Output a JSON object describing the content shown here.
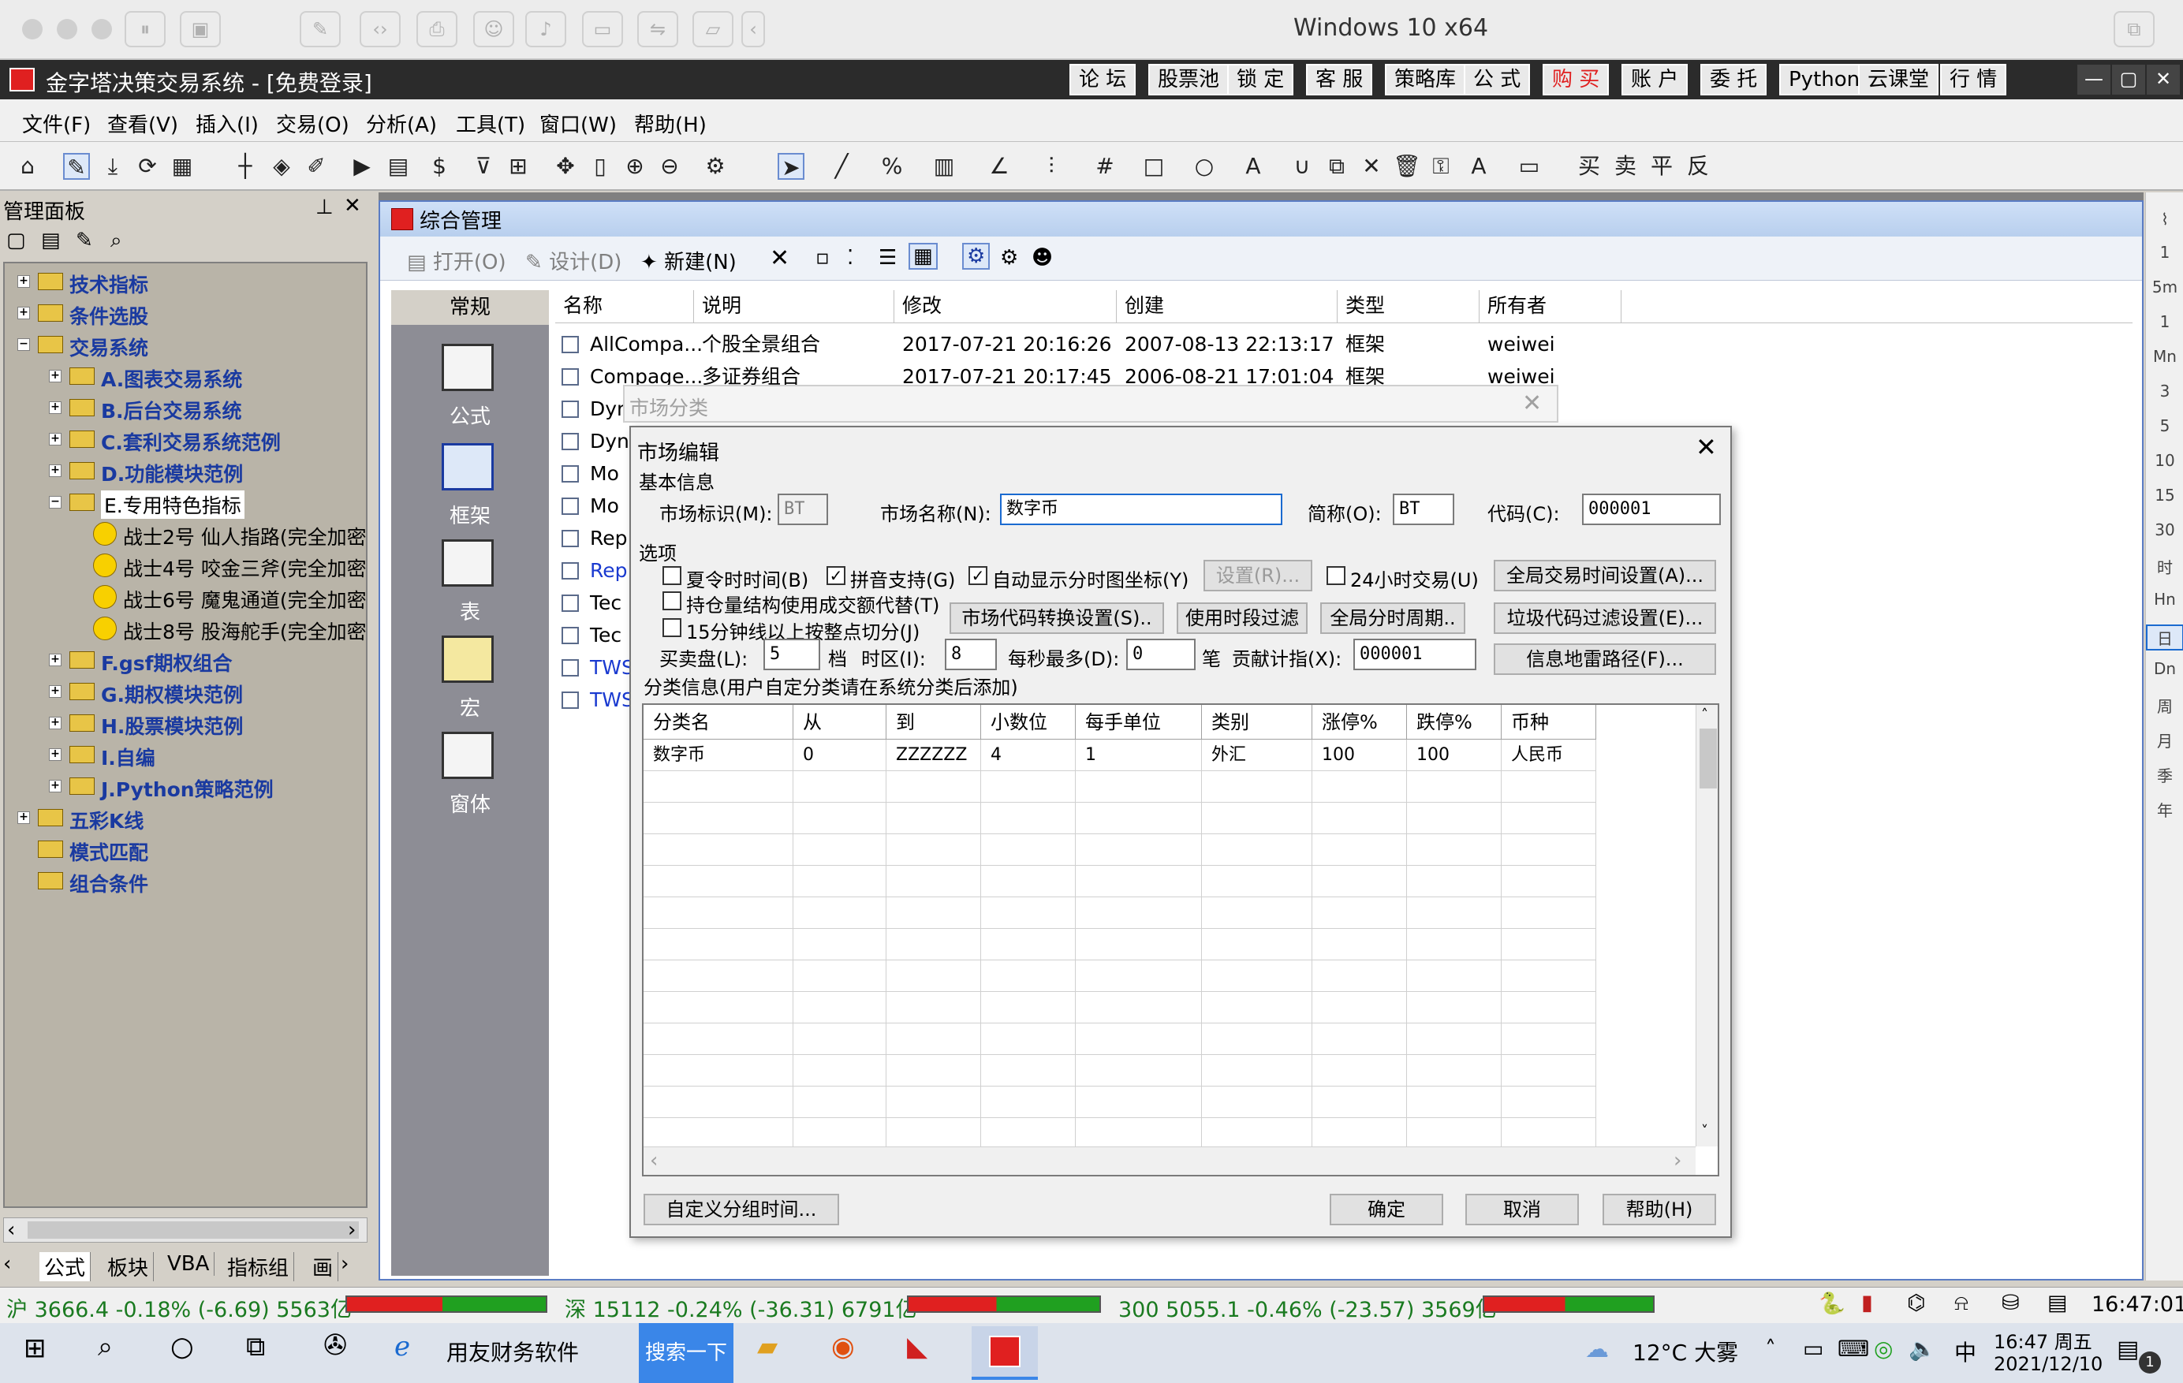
{
  "vm": {
    "title": "Windows 10 x64"
  },
  "app": {
    "title": "金字塔决策交易系统 - [免费登录]",
    "buttons": [
      "论 坛",
      "股票池",
      "锁 定",
      "客 服",
      "策略库",
      "公 式",
      "购 买",
      "账 户",
      "委 托",
      "Python",
      "云课堂",
      "行 情"
    ],
    "accent": "#e02020"
  },
  "menu": [
    "文件(F)",
    "查看(V)",
    "插入(I)",
    "交易(O)",
    "分析(A)",
    "工具(T)",
    "窗口(W)",
    "帮助(H)"
  ],
  "left": {
    "title": "管理面板",
    "tree": [
      {
        "label": "技术指标",
        "depth": 0,
        "expand": "+"
      },
      {
        "label": "条件选股",
        "depth": 0,
        "expand": "+"
      },
      {
        "label": "交易系统",
        "depth": 0,
        "expand": "-"
      },
      {
        "label": "A.图表交易系统",
        "depth": 1,
        "expand": "+"
      },
      {
        "label": "B.后台交易系统",
        "depth": 1,
        "expand": "+"
      },
      {
        "label": "C.套利交易系统范例",
        "depth": 1,
        "expand": "+"
      },
      {
        "label": "D.功能模块范例",
        "depth": 1,
        "expand": "+"
      },
      {
        "label": "E.专用特色指标",
        "depth": 1,
        "expand": "-"
      },
      {
        "label": "战士2号    仙人指路(完全加密",
        "depth": 2,
        "expand": ""
      },
      {
        "label": "战士4号    咬金三斧(完全加密",
        "depth": 2,
        "expand": ""
      },
      {
        "label": "战士6号    魔鬼通道(完全加密",
        "depth": 2,
        "expand": ""
      },
      {
        "label": "战士8号    股海舵手(完全加密",
        "depth": 2,
        "expand": ""
      },
      {
        "label": "F.gsf期权组合",
        "depth": 1,
        "expand": "+"
      },
      {
        "label": "G.期权模块范例",
        "depth": 1,
        "expand": "+"
      },
      {
        "label": "H.股票模块范例",
        "depth": 1,
        "expand": "+"
      },
      {
        "label": "I.自编",
        "depth": 1,
        "expand": "+"
      },
      {
        "label": "J.Python策略范例",
        "depth": 1,
        "expand": "+"
      },
      {
        "label": "五彩K线",
        "depth": 0,
        "expand": "+"
      },
      {
        "label": "模式匹配",
        "depth": 0,
        "expand": ""
      },
      {
        "label": "组合条件",
        "depth": 0,
        "expand": ""
      }
    ],
    "tabs": [
      "公式",
      "板块",
      "VBA",
      "指标组",
      "画"
    ]
  },
  "mg": {
    "title": "综合管理",
    "tools": [
      "打开(O)",
      "设计(D)",
      "新建(N)"
    ],
    "cats": [
      "常规",
      "公式",
      "框架",
      "表",
      "宏",
      "窗体"
    ],
    "columns": [
      "名称",
      "说明",
      "修改",
      "创建",
      "类型",
      "所有者"
    ],
    "rows": [
      [
        "AllCompa...",
        "个股全景组合",
        "2017-07-21 20:16:26",
        "2007-08-13 22:13:17",
        "框架",
        "weiwei"
      ],
      [
        "Compage...",
        "多证券组合",
        "2017-07-21 20:17:45",
        "2006-08-21 17:01:04",
        "框架",
        "weiwei"
      ],
      [
        "Dyn",
        "",
        "",
        "",
        "",
        ""
      ],
      [
        "Dyn",
        "",
        "",
        "",
        "",
        ""
      ],
      [
        "Mo",
        "",
        "",
        "",
        "",
        ""
      ],
      [
        "Mo",
        "",
        "",
        "",
        "",
        ""
      ],
      [
        "Rep",
        "",
        "",
        "",
        "",
        ""
      ],
      [
        "Rep",
        "",
        "",
        "",
        "",
        ""
      ],
      [
        "Tec",
        "",
        "",
        "",
        "",
        ""
      ],
      [
        "Tec",
        "",
        "",
        "",
        "",
        ""
      ],
      [
        "TWS",
        "",
        "",
        "",
        "",
        ""
      ],
      [
        "TWS",
        "",
        "",
        "",
        "",
        ""
      ]
    ]
  },
  "market_dlg": {
    "title": "市场分类"
  },
  "dlg": {
    "title": "市场编辑",
    "basic": "基本信息",
    "id_label": "市场标识(M):",
    "id_value": "BT",
    "name_label": "市场名称(N):",
    "name_value": "数字币",
    "abbr_label": "简称(O):",
    "abbr_value": "BT",
    "code_label": "代码(C):",
    "code_value": "000001",
    "options": "选项",
    "chk_dst": "夏令时时间(B)",
    "chk_pinyin": "拼音支持(G)",
    "chk_auto": "自动显示分时图坐标(Y)",
    "btn_set": "设置(R)...",
    "chk_24": "24小时交易(U)",
    "btn_global_time": "全局交易时间设置(A)...",
    "chk_pos": "持仓量结构使用成交额代替(T)",
    "btn_code_conv": "市场代码转换设置(S)..",
    "btn_period_filter": "使用时段过滤",
    "btn_global_period": "全局分时周期..",
    "btn_garbage": "垃圾代码过滤设置(E)...",
    "chk_15": "15分钟线以上按整点切分(J)",
    "buysell_label": "买卖盘(L):",
    "buysell_value": "5",
    "buysell_unit": "档",
    "tz_label": "时区(I):",
    "tz_value": "8",
    "maxps_label": "每秒最多(D):",
    "maxps_value": "0",
    "maxps_unit": "笔",
    "contrib_label": "贡献计指(X):",
    "contrib_value": "000001",
    "btn_mine": "信息地雷路径(F)...",
    "classinfo": "分类信息(用户自定分类请在系统分类后添加)",
    "grid_headers": [
      "分类名",
      "从",
      "到",
      "小数位",
      "每手单位",
      "类别",
      "涨停%",
      "跌停%",
      "币种"
    ],
    "grid_row": [
      "数字币",
      "0",
      "ZZZZZZ",
      "4",
      "1",
      "外汇",
      "100",
      "100",
      "人民币"
    ],
    "btn_custom": "自定义分组时间...",
    "btn_ok": "确定",
    "btn_cancel": "取消",
    "btn_help": "帮助(H)"
  },
  "right_strip": [
    "1",
    "5m",
    "1",
    "Mn",
    "3",
    "5",
    "10",
    "15",
    "30",
    "时",
    "Hn",
    "日",
    "Dn",
    "周",
    "月",
    "季",
    "年"
  ],
  "status": {
    "sh": "沪 3666.4 -0.18% (-6.69) 5563亿",
    "sz": "深 15112 -0.24% (-36.31) 6791亿",
    "hs300": "300 5055.1 -0.46% (-23.57) 3569亿",
    "time": "16:47:01"
  },
  "taskbar": {
    "app": "用友财务软件",
    "search": "搜索一下",
    "weather": "12°C 大雾",
    "ime": "中",
    "clock_time": "16:47 周五",
    "clock_date": "2021/12/10",
    "notif": "1"
  }
}
